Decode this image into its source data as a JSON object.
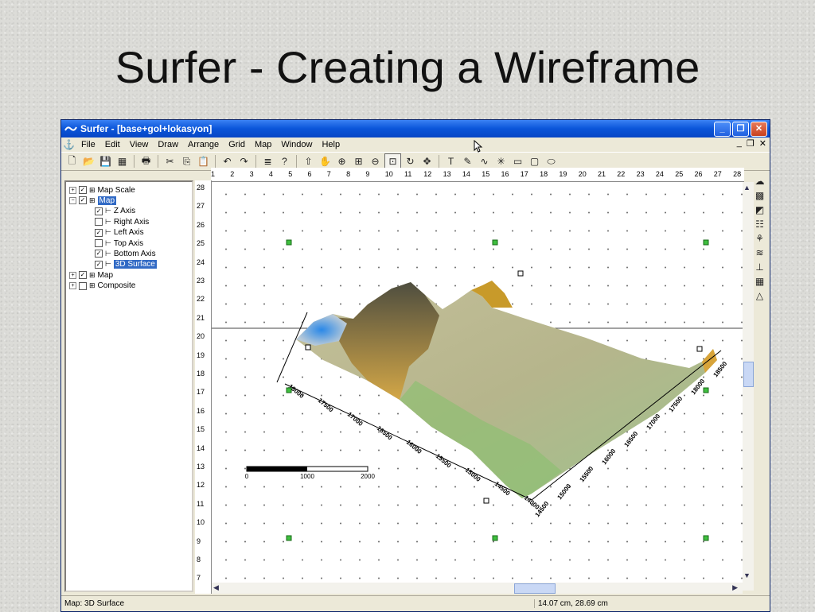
{
  "slide": {
    "title": "Surfer - Creating a Wireframe"
  },
  "window": {
    "title": "Surfer - [base+gol+lokasyon]",
    "minimize": "_",
    "maximize": "❐",
    "close": "✕"
  },
  "menu": [
    "File",
    "Edit",
    "View",
    "Draw",
    "Arrange",
    "Grid",
    "Map",
    "Window",
    "Help"
  ],
  "mdi_controls": [
    "_",
    "❐",
    "✕"
  ],
  "toolbar": {
    "icons": [
      "new-icon",
      "open-icon",
      "save-icon",
      "table-icon",
      "print-icon",
      "cut-icon",
      "copy-icon",
      "paste-icon",
      "undo-icon",
      "redo-icon",
      "object-manager-icon",
      "whats-this-icon",
      "select-icon",
      "pan-icon",
      "zoom-in-icon",
      "zoom-rect-icon",
      "zoom-out-icon",
      "zoom-page-icon",
      "rotate-icon",
      "reshape-icon",
      "text-icon",
      "polygon-icon",
      "polyline-icon",
      "symbol-icon",
      "rectangle-icon",
      "rounded-rect-icon",
      "ellipse-icon"
    ],
    "glyphs": [
      "🗋",
      "📂",
      "💾",
      "▦",
      "🖶",
      "✂",
      "⎘",
      "📋",
      "↶",
      "↷",
      "≣",
      "?",
      "⇧",
      "✋",
      "⊕",
      "⊞",
      "⊖",
      "⊡",
      "↻",
      "✥",
      "T",
      "✎",
      "∿",
      "✳",
      "▭",
      "▢",
      "⬭"
    ]
  },
  "object_manager": {
    "items": [
      {
        "label": "Map Scale",
        "checked": true,
        "level": 0
      },
      {
        "label": "Map",
        "checked": true,
        "level": 0,
        "expanded": true,
        "selected": true
      },
      {
        "label": "Z Axis",
        "checked": true,
        "level": 1
      },
      {
        "label": "Right Axis",
        "checked": false,
        "level": 1
      },
      {
        "label": "Left Axis",
        "checked": true,
        "level": 1
      },
      {
        "label": "Top Axis",
        "checked": false,
        "level": 1
      },
      {
        "label": "Bottom Axis",
        "checked": true,
        "level": 1
      },
      {
        "label": "3D Surface",
        "checked": true,
        "level": 1,
        "selected": true
      },
      {
        "label": "Map",
        "checked": true,
        "level": 0
      },
      {
        "label": "Composite",
        "checked": false,
        "level": 0
      }
    ]
  },
  "ruler_top": [
    "1",
    "2",
    "3",
    "4",
    "5",
    "6",
    "7",
    "8",
    "9",
    "10",
    "11",
    "12",
    "13",
    "14",
    "15",
    "16",
    "17",
    "18",
    "19",
    "20",
    "21",
    "22",
    "23",
    "24",
    "25",
    "26",
    "27",
    "28"
  ],
  "ruler_left": [
    "28",
    "27",
    "26",
    "25",
    "24",
    "23",
    "22",
    "21",
    "20",
    "19",
    "18",
    "17",
    "16",
    "15",
    "14",
    "13",
    "12",
    "11",
    "10",
    "9",
    "8",
    "7"
  ],
  "scale_bar": {
    "labels": [
      "0",
      "1000",
      "2000"
    ]
  },
  "axis_left_labels": [
    "18000",
    "17500",
    "17000",
    "16500",
    "16000",
    "15500",
    "15000",
    "14500",
    "14000"
  ],
  "axis_right_labels": [
    "14500",
    "15000",
    "15500",
    "16000",
    "16500",
    "17000",
    "17500",
    "18000",
    "18500"
  ],
  "status": {
    "left": "Map: 3D Surface",
    "right": "14.07 cm, 28.69 cm"
  },
  "colors": {
    "titlebar": "#0a55d9",
    "selection": "#316ac5",
    "surface_green": "#8fbf72",
    "surface_tan": "#b4b38a"
  }
}
